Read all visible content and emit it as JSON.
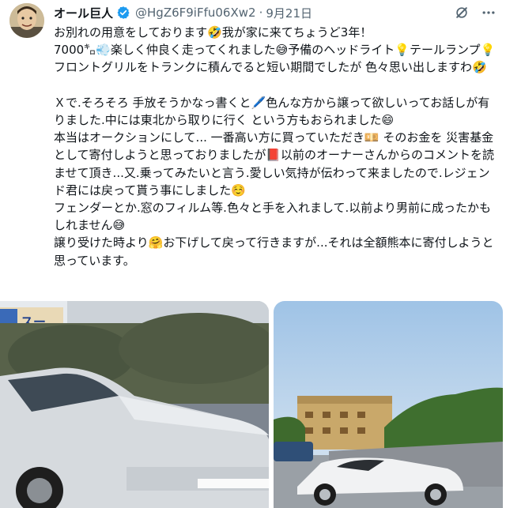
{
  "tweet": {
    "display_name": "オール巨人",
    "handle": "@HgZ6F9iFfu06Xw2",
    "separator": "·",
    "date": "9月21日",
    "text": "お別れの用意をしております🤣我が家に来てちょうど3年！\n7000㌔💨楽しく仲良く走ってくれました😅予備のヘッドライト💡テールランプ💡 フロントグリルをトランクに積んでると短い期間でしたが 色々思い出しますわ🤣\n\nＸで.そろそろ 手放そうかなっ書くと🖊️色んな方から譲って欲しいってお話しが有りました.中には東北から取りに行く という方もおられました😄\n本当はオークションにして... 一番高い方に買っていただき💴 そのお金を 災害基金として寄付しようと思っておりましたが📕以前のオーナーさんからのコメントを読ませて頂き...又.乗ってみたいと言う.愛しい気持が伝わって来ましたので.レジェンド君には戻って貰う事にしました☺️\nフェンダーとか.窓のフィルム等.色々と手を入れまして.以前より男前に成ったかもしれません😅\n譲り受けた時より🤗お下げして戻って行きますが...それは全額熊本に寄付しようと思っています。"
  },
  "icons": {
    "verified": "verified-badge-icon",
    "grok": "grok-icon",
    "more": "more-options-icon"
  },
  "colors": {
    "verified": "#1d9bf0",
    "text": "#0f1419",
    "secondary": "#536471"
  },
  "media": [
    {
      "name": "car-photo-left",
      "sign_text": "スー"
    },
    {
      "name": "car-photo-right"
    }
  ]
}
